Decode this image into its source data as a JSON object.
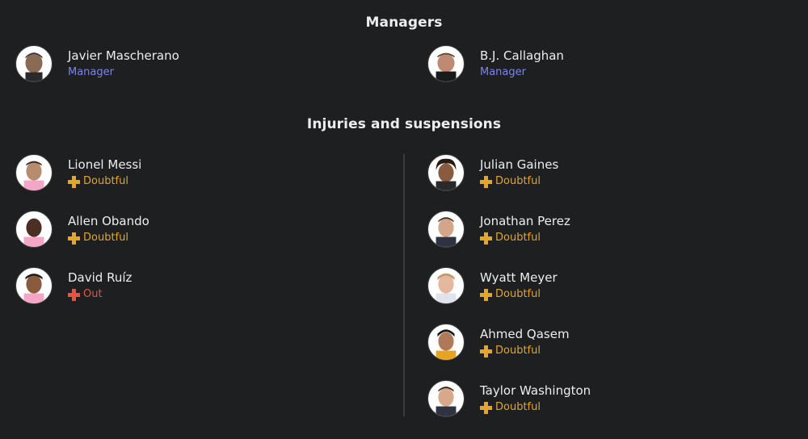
{
  "managers": {
    "title": "Managers",
    "items": [
      {
        "name": "Javier Mascherano",
        "role": "Manager"
      },
      {
        "name": "B.J. Callaghan",
        "role": "Manager"
      }
    ]
  },
  "injuries": {
    "title": "Injuries and suspensions",
    "left": [
      {
        "name": "Lionel Messi",
        "status": "Doubtful"
      },
      {
        "name": "Allen Obando",
        "status": "Doubtful"
      },
      {
        "name": "David Ruíz",
        "status": "Out"
      }
    ],
    "right": [
      {
        "name": "Julian Gaines",
        "status": "Doubtful"
      },
      {
        "name": "Jonathan Perez",
        "status": "Doubtful"
      },
      {
        "name": "Wyatt Meyer",
        "status": "Doubtful"
      },
      {
        "name": "Ahmed Qasem",
        "status": "Doubtful"
      },
      {
        "name": "Taylor Washington",
        "status": "Doubtful"
      }
    ]
  },
  "colors": {
    "background": "#1d1f21",
    "manager_role": "#7b83f5",
    "doubtful": "#e4a52a",
    "out": "#e8533f"
  },
  "icons": {
    "doubtful": "plus-cross-icon",
    "out": "plus-cross-icon"
  }
}
